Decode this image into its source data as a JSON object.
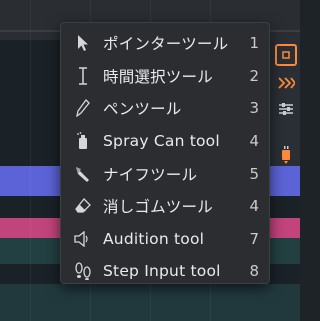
{
  "menu": {
    "items": [
      {
        "label": "ポインターツール",
        "shortcut": "1",
        "icon": "pointer-icon"
      },
      {
        "label": "時間選択ツール",
        "shortcut": "2",
        "icon": "text-cursor-icon"
      },
      {
        "label": "ペンツール",
        "shortcut": "3",
        "icon": "pen-icon"
      },
      {
        "label": "Spray Can tool",
        "shortcut": "4",
        "icon": "spray-can-icon"
      },
      {
        "label": "ナイフツール",
        "shortcut": "5",
        "icon": "knife-icon"
      },
      {
        "label": "消しゴムツール",
        "shortcut": "4",
        "icon": "eraser-icon"
      },
      {
        "label": "Audition tool",
        "shortcut": "7",
        "icon": "speaker-icon"
      },
      {
        "label": "Step Input tool",
        "shortcut": "8",
        "icon": "footsteps-icon"
      }
    ]
  },
  "colors": {
    "accent": "#ff8a3d",
    "menu_bg": "#2b2d31",
    "clip_blue": "#5b63d6",
    "clip_pink": "#c2447c"
  }
}
